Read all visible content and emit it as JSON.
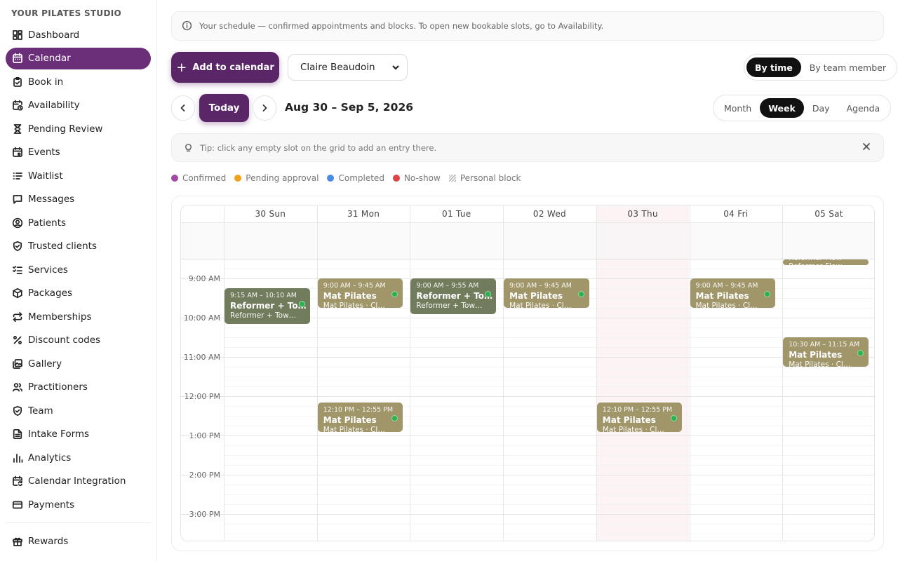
{
  "sidebar": {
    "brand": "YOUR PILATES STUDIO",
    "items": [
      {
        "label": "Dashboard",
        "icon": "dashboard-icon"
      },
      {
        "label": "Calendar",
        "icon": "calendar-icon",
        "active": true
      },
      {
        "label": "Book in",
        "icon": "clipboard-icon"
      },
      {
        "label": "Availability",
        "icon": "calendar-clock-icon"
      },
      {
        "label": "Pending Review",
        "icon": "hourglass-icon"
      },
      {
        "label": "Events",
        "icon": "calendar-event-icon"
      },
      {
        "label": "Waitlist",
        "icon": "list-icon"
      },
      {
        "label": "Messages",
        "icon": "message-icon"
      },
      {
        "label": "Patients",
        "icon": "user-circle-icon"
      },
      {
        "label": "Trusted clients",
        "icon": "shield-check-icon"
      },
      {
        "label": "Services",
        "icon": "checklist-icon"
      },
      {
        "label": "Packages",
        "icon": "package-icon"
      },
      {
        "label": "Memberships",
        "icon": "repeat-icon"
      },
      {
        "label": "Discount codes",
        "icon": "percent-icon"
      },
      {
        "label": "Gallery",
        "icon": "gallery-icon"
      },
      {
        "label": "Practitioners",
        "icon": "users-icon"
      },
      {
        "label": "Team",
        "icon": "shield-icon"
      },
      {
        "label": "Intake Forms",
        "icon": "form-icon"
      },
      {
        "label": "Analytics",
        "icon": "bar-chart-icon"
      },
      {
        "label": "Calendar Integration",
        "icon": "calendar-sync-icon"
      },
      {
        "label": "Payments",
        "icon": "credit-card-icon"
      }
    ],
    "secondary": [
      {
        "label": "Rewards",
        "icon": "gift-icon"
      }
    ]
  },
  "banner": {
    "text": "Your schedule — confirmed appointments and blocks. To open new bookable slots, go to Availability."
  },
  "toolbar": {
    "add_label": "Add to calendar",
    "member_selected": "Claire Beaudoin",
    "mode_options": [
      "By time",
      "By team member"
    ],
    "mode_selected": "By time",
    "today_label": "Today",
    "date_range": "Aug 30 – Sep 5, 2026",
    "view_options": [
      "Month",
      "Week",
      "Day",
      "Agenda"
    ],
    "view_selected": "Week"
  },
  "tip": {
    "text": "Tip: click any empty slot on the grid to add an entry there."
  },
  "legend": [
    {
      "label": "Confirmed",
      "color": "#a24aa5"
    },
    {
      "label": "Pending approval",
      "color": "#f0a21b"
    },
    {
      "label": "Completed",
      "color": "#4a8ce5"
    },
    {
      "label": "No-show",
      "color": "#e04343"
    },
    {
      "label": "Personal block",
      "pattern": "hatch"
    }
  ],
  "calendar": {
    "days": [
      "30 Sun",
      "31 Mon",
      "01 Tue",
      "02 Wed",
      "03 Thu",
      "04 Fri",
      "05 Sat"
    ],
    "today_index": 4,
    "hours": [
      "9:00 AM",
      "10:00 AM",
      "11:00 AM",
      "12:00 PM",
      "1:00 PM",
      "2:00 PM",
      "3:00 PM"
    ],
    "appointments": [
      {
        "day": 0,
        "start": 9.25,
        "end": 10.1667,
        "time": "9:15 AM – 10:10 AM",
        "name": "Reformer + To…",
        "sub": "Reformer + Tow…",
        "kind": "ref"
      },
      {
        "day": 1,
        "start": 9.0,
        "end": 9.75,
        "time": "9:00 AM – 9:45 AM",
        "name": "Mat Pilates",
        "sub": "Mat Pilates · Cl…",
        "kind": "mat"
      },
      {
        "day": 2,
        "start": 9.0,
        "end": 9.9167,
        "time": "9:00 AM – 9:55 AM",
        "name": "Reformer + To…",
        "sub": "Reformer + Tow…",
        "kind": "ref"
      },
      {
        "day": 3,
        "start": 9.0,
        "end": 9.75,
        "time": "9:00 AM – 9:45 AM",
        "name": "Mat Pilates",
        "sub": "Mat Pilates · Cl…",
        "kind": "mat"
      },
      {
        "day": 5,
        "start": 9.0,
        "end": 9.75,
        "time": "9:00 AM – 9:45 AM",
        "name": "Mat Pilates",
        "sub": "Mat Pilates · Cl…",
        "kind": "mat"
      },
      {
        "day": 6,
        "start": 10.5,
        "end": 11.25,
        "time": "10:30 AM – 11:15 AM",
        "name": "Mat Pilates",
        "sub": "Mat Pilates · Cl…",
        "kind": "mat"
      },
      {
        "day": 1,
        "start": 12.1667,
        "end": 12.9167,
        "time": "12:10 PM – 12:55 PM",
        "name": "Mat Pilates",
        "sub": "Mat Pilates · Cl…",
        "kind": "mat"
      },
      {
        "day": 4,
        "start": 12.1667,
        "end": 12.9167,
        "time": "12:10 PM – 12:55 PM",
        "name": "Mat Pilates",
        "sub": "Mat Pilates · Cl…",
        "kind": "mat"
      },
      {
        "day": 6,
        "start": 7.8,
        "end": 8.28,
        "time": "",
        "name": "Reformer Flow",
        "sub": "Reformer Flow",
        "kind": "mat",
        "clipped": true
      }
    ]
  }
}
